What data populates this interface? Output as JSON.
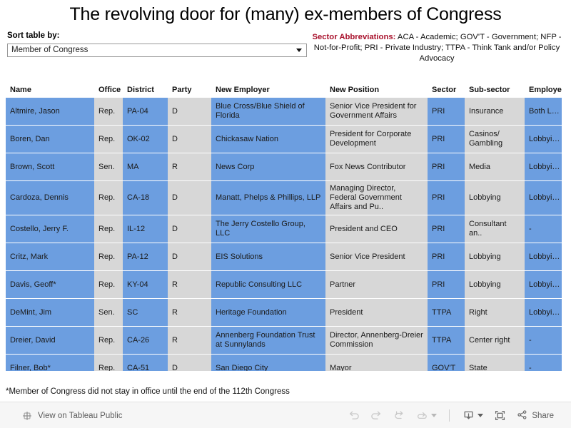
{
  "title": "The revolving door for (many) ex-members of Congress",
  "sort": {
    "label": "Sort table by:",
    "value": "Member of Congress",
    "caret_icon": "chevron-down-icon"
  },
  "abbreviations": {
    "heading": "Sector Abbreviations:",
    "text": " ACA - Academic; GOV'T - Government; NFP - Not-for-Profit; PRI - Private Industry; TTPA - Think Tank and/or Policy Advocacy"
  },
  "table": {
    "columns": [
      "Name",
      "Office",
      "District",
      "Party",
      "New Employer",
      "New Position",
      "Sector",
      "Sub-sector",
      "Employer Lobbies"
    ],
    "rows": [
      {
        "name": "Altmire, Jason",
        "office": "Rep.",
        "district": "PA-04",
        "party": "D",
        "employer": "Blue Cross/Blue Shield of Florida",
        "position": "Senior Vice President for Government Affairs",
        "sector": "PRI",
        "subsector": "Insurance",
        "emplobby": "Both L…"
      },
      {
        "name": "Boren, Dan",
        "office": "Rep.",
        "district": "OK-02",
        "party": "D",
        "employer": "Chickasaw Nation",
        "position": "President for Corporate Development",
        "sector": "PRI",
        "subsector": "Casinos/ Gambling",
        "emplobby": "Lobbyi…"
      },
      {
        "name": "Brown, Scott",
        "office": "Sen.",
        "district": "MA",
        "party": "R",
        "employer": "News Corp",
        "position": "Fox News Contributor",
        "sector": "PRI",
        "subsector": "Media",
        "emplobby": "Lobbyi…"
      },
      {
        "name": "Cardoza, Dennis",
        "office": "Rep.",
        "district": "CA-18",
        "party": "D",
        "employer": "Manatt, Phelps & Phillips, LLP",
        "position": "Managing Director, Federal Government Affairs and Pu..",
        "sector": "PRI",
        "subsector": "Lobbying",
        "emplobby": "Lobbyi…"
      },
      {
        "name": "Costello, Jerry F.",
        "office": "Rep.",
        "district": "IL-12",
        "party": "D",
        "employer": "The Jerry Costello Group, LLC",
        "position": "President and CEO",
        "sector": "PRI",
        "subsector": "Consultant an..",
        "emplobby": "-"
      },
      {
        "name": "Critz, Mark",
        "office": "Rep.",
        "district": "PA-12",
        "party": "D",
        "employer": "EIS Solutions",
        "position": "Senior Vice President",
        "sector": "PRI",
        "subsector": "Lobbying",
        "emplobby": "Lobbyi…"
      },
      {
        "name": "Davis, Geoff*",
        "office": "Rep.",
        "district": "KY-04",
        "party": "R",
        "employer": "Republic Consulting LLC",
        "position": "Partner",
        "sector": "PRI",
        "subsector": "Lobbying",
        "emplobby": "Lobbyi…"
      },
      {
        "name": "DeMint, Jim",
        "office": "Sen.",
        "district": "SC",
        "party": "R",
        "employer": "Heritage Foundation",
        "position": "President",
        "sector": "TTPA",
        "subsector": "Right",
        "emplobby": "Lobbyi…"
      },
      {
        "name": "Dreier, David",
        "office": "Rep.",
        "district": "CA-26",
        "party": "R",
        "employer": "Annenberg Foundation Trust at Sunnylands",
        "position": "Director, Annenberg-Dreier Commission",
        "sector": "TTPA",
        "subsector": "Center right",
        "emplobby": "-"
      },
      {
        "name": "Filner, Bob*",
        "office": "Rep.",
        "district": "CA-51",
        "party": "D",
        "employer": "San Diego City",
        "position": "Mayor",
        "sector": "GOV'T",
        "subsector": "State",
        "emplobby": "-"
      },
      {
        "name": "",
        "office": "",
        "district": "",
        "party": "",
        "employer": "",
        "position": "",
        "sector": "",
        "subsector": "",
        "emplobby": ""
      }
    ]
  },
  "footnote": "*Member of Congress did not stay in office until the end of the 112th Congress",
  "toolbar": {
    "view_label": "View on Tableau Public",
    "tableau_icon": "tableau-logo-icon",
    "undo_icon": "undo-icon",
    "redo_icon": "redo-icon",
    "revert_icon": "revert-icon",
    "refresh_icon": "refresh-icon",
    "pause_caret_icon": "chevron-down-icon",
    "download_icon": "download-icon",
    "download_caret_icon": "chevron-down-icon",
    "fullscreen_icon": "fullscreen-icon",
    "share_icon": "share-icon",
    "share_label": "Share"
  },
  "colors": {
    "cell_blue": "#6c9ee0",
    "cell_gray": "#d7d7d7",
    "accent_red": "#a8102b",
    "toolbar_bg": "#f6f6f6"
  }
}
